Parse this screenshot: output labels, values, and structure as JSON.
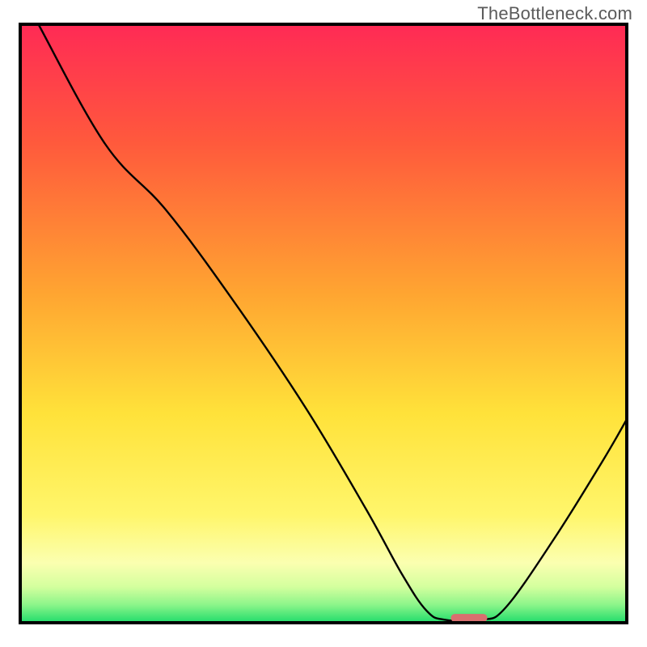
{
  "watermark": "TheBottleneck.com",
  "chart_data": {
    "type": "line",
    "title": "",
    "xlabel": "",
    "ylabel": "",
    "x_range": [
      0,
      100
    ],
    "y_range": [
      0,
      100
    ],
    "gradient_stops": [
      {
        "offset": 0,
        "color": "#ff2a55"
      },
      {
        "offset": 20,
        "color": "#ff5a3c"
      },
      {
        "offset": 45,
        "color": "#ffa531"
      },
      {
        "offset": 65,
        "color": "#ffe23a"
      },
      {
        "offset": 82,
        "color": "#fff66b"
      },
      {
        "offset": 90,
        "color": "#fbffb0"
      },
      {
        "offset": 94,
        "color": "#d4ff9e"
      },
      {
        "offset": 97,
        "color": "#8cf58a"
      },
      {
        "offset": 100,
        "color": "#1fdc6b"
      }
    ],
    "curve_points": [
      {
        "x": 3.0,
        "y": 100.0
      },
      {
        "x": 14.0,
        "y": 80.0
      },
      {
        "x": 24.0,
        "y": 69.0
      },
      {
        "x": 35.0,
        "y": 54.0
      },
      {
        "x": 47.0,
        "y": 36.0
      },
      {
        "x": 57.0,
        "y": 19.0
      },
      {
        "x": 63.0,
        "y": 8.0
      },
      {
        "x": 67.0,
        "y": 2.0
      },
      {
        "x": 70.0,
        "y": 0.5
      },
      {
        "x": 76.0,
        "y": 0.5
      },
      {
        "x": 80.0,
        "y": 2.5
      },
      {
        "x": 88.0,
        "y": 14.0
      },
      {
        "x": 96.0,
        "y": 27.0
      },
      {
        "x": 100.0,
        "y": 34.0
      }
    ],
    "marker": {
      "x_start": 71.0,
      "x_end": 77.0,
      "y": 0.8,
      "color": "#d96f6f"
    },
    "border_color": "#000000"
  }
}
